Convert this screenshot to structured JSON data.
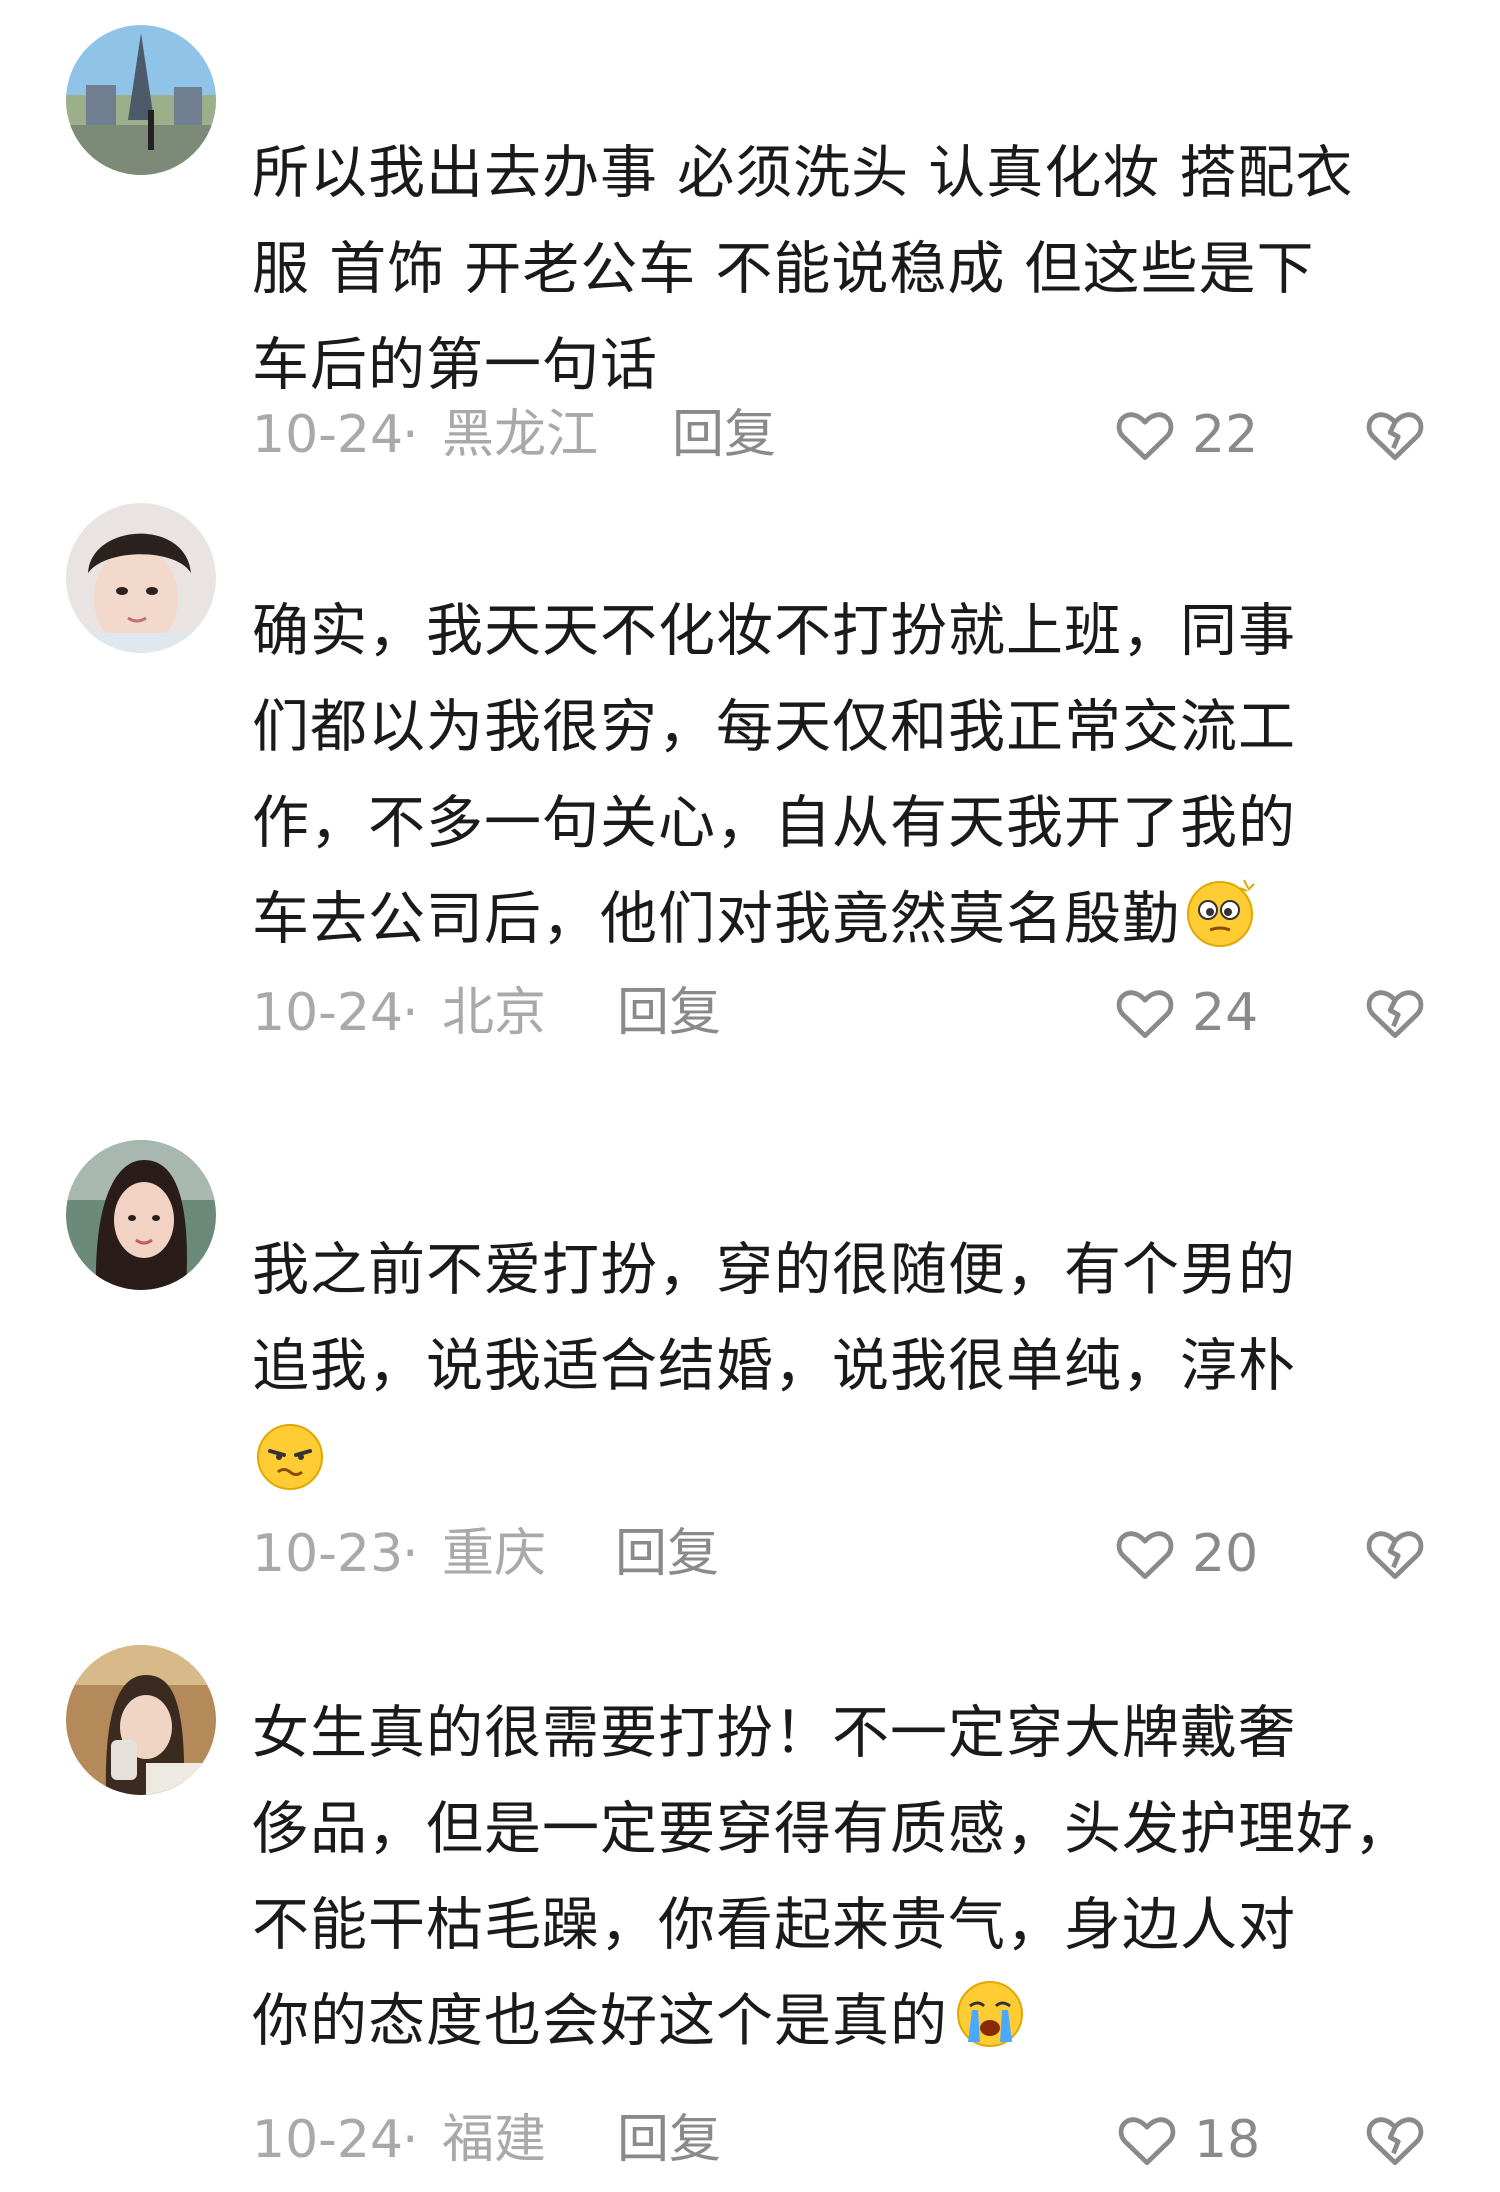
{
  "comments": [
    {
      "lines": [
        "所以我出去办事 必须洗头 认真化妆 搭配衣",
        "服 首饰 开老公车 不能说稳成 但这些是下",
        "车后的第一句话"
      ],
      "emoji": null,
      "date": "10-24",
      "region": "黑龙江",
      "reply": "回复",
      "likes": "22"
    },
    {
      "lines": [
        "确实，我天天不化妆不打扮就上班，同事",
        "们都以为我很穷，每天仅和我正常交流工",
        "作，不多一句关心，自从有天我开了我的",
        "车去公司后，他们对我竟然莫名殷勤"
      ],
      "emoji": "dizzy-face-emoji",
      "date": "10-24",
      "region": "北京",
      "reply": "回复",
      "likes": "24"
    },
    {
      "lines": [
        "我之前不爱打扮，穿的很随便，有个男的",
        "追我，说我适合结婚，说我很单纯，淳朴"
      ],
      "emoji": "annoyed-face-emoji",
      "date": "10-23",
      "region": "重庆",
      "reply": "回复",
      "likes": "20"
    },
    {
      "lines": [
        "女生真的很需要打扮！不一定穿大牌戴奢",
        "侈品，但是一定要穿得有质感，头发护理好，",
        "不能干枯毛躁，你看起来贵气，身边人对",
        "你的态度也会好这个是真的"
      ],
      "emoji": "crying-face-emoji",
      "date": "10-24",
      "region": "福建",
      "reply": "回复",
      "likes": "18"
    }
  ],
  "separator": "·"
}
